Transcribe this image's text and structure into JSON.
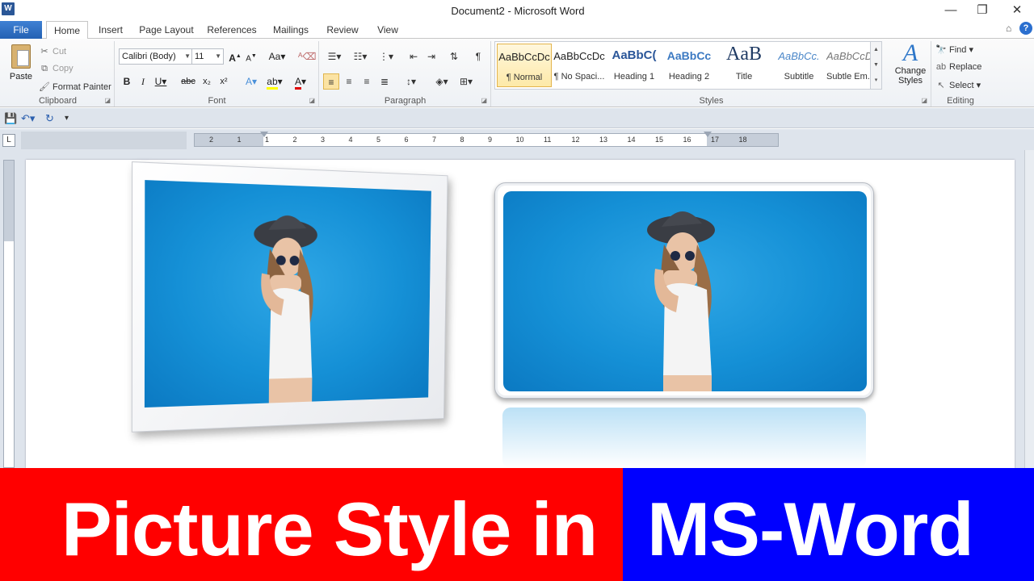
{
  "window": {
    "title": "Document2 - Microsoft Word",
    "app_icon": "W"
  },
  "tabs": [
    {
      "label": "File"
    },
    {
      "label": "Home"
    },
    {
      "label": "Insert"
    },
    {
      "label": "Page Layout"
    },
    {
      "label": "References"
    },
    {
      "label": "Mailings"
    },
    {
      "label": "Review"
    },
    {
      "label": "View"
    }
  ],
  "active_tab": "Home",
  "clipboard": {
    "paste": "Paste",
    "cut": "Cut",
    "copy": "Copy",
    "format_painter": "Format Painter",
    "label": "Clipboard"
  },
  "font": {
    "name": "Calibri (Body)",
    "size": "11",
    "label": "Font"
  },
  "paragraph": {
    "label": "Paragraph"
  },
  "styles": {
    "label": "Styles",
    "items": [
      {
        "sample": "AaBbCcDc",
        "name": "¶ Normal"
      },
      {
        "sample": "AaBbCcDc",
        "name": "¶ No Spaci..."
      },
      {
        "sample": "AaBbC(",
        "name": "Heading 1"
      },
      {
        "sample": "AaBbCc",
        "name": "Heading 2"
      },
      {
        "sample": "AaB",
        "name": "Title"
      },
      {
        "sample": "AaBbCc.",
        "name": "Subtitle"
      },
      {
        "sample": "AaBbCcDc",
        "name": "Subtle Em..."
      }
    ],
    "change_styles": "Change Styles"
  },
  "editing": {
    "find": "Find",
    "replace": "Replace",
    "select": "Select",
    "label": "Editing"
  },
  "ruler": {
    "numbers": [
      "2",
      "1",
      "1",
      "2",
      "3",
      "4",
      "5",
      "6",
      "7",
      "8",
      "9",
      "10",
      "11",
      "12",
      "13",
      "14",
      "15",
      "16",
      "17",
      "18"
    ]
  },
  "banner": {
    "left_text": "Picture Style in",
    "right_text": "MS-Word",
    "left_color": "#ff0000",
    "right_color": "#0000ff"
  },
  "colors": {
    "accent": "#2b5797",
    "file_tab": "#2b6cc4",
    "selected_style": "#fde9a8"
  }
}
